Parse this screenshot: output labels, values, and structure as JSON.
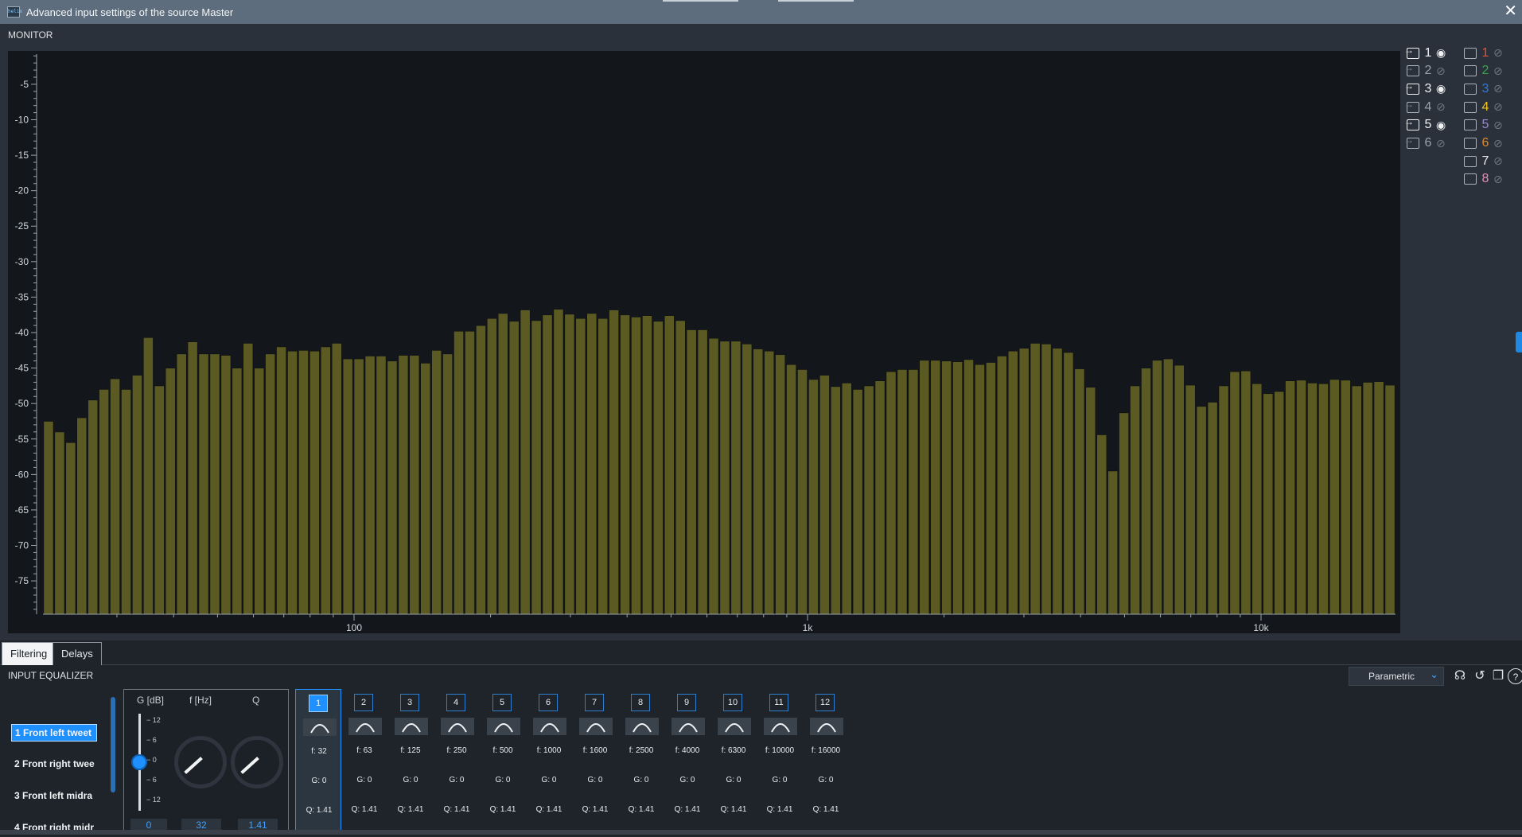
{
  "window": {
    "title": "Advanced input settings of the source Master",
    "close_glyph": "✕"
  },
  "monitor": {
    "label": "MONITOR",
    "help_glyph": "?",
    "input_channels": [
      {
        "num": "1",
        "visible": true
      },
      {
        "num": "2",
        "visible": false
      },
      {
        "num": "3",
        "visible": true
      },
      {
        "num": "4",
        "visible": false
      },
      {
        "num": "5",
        "visible": true
      },
      {
        "num": "6",
        "visible": false
      }
    ],
    "output_channels": [
      {
        "num": "1",
        "color": "#e0533a"
      },
      {
        "num": "2",
        "color": "#3aa34a"
      },
      {
        "num": "3",
        "color": "#2e7bd6"
      },
      {
        "num": "4",
        "color": "#f3c324"
      },
      {
        "num": "5",
        "color": "#9a8ad0"
      },
      {
        "num": "6",
        "color": "#e08a2a"
      },
      {
        "num": "7",
        "color": "#e9ecef"
      },
      {
        "num": "8",
        "color": "#e48fb8"
      }
    ]
  },
  "chart_data": {
    "type": "bar",
    "title": "",
    "xlabel": "",
    "ylabel": "",
    "x_scale": "log",
    "x_tick_labels": [
      "100",
      "1k",
      "10k"
    ],
    "y_tick_labels": [
      "-5",
      "-10",
      "-15",
      "-20",
      "-25",
      "-30",
      "-35",
      "-40",
      "-45",
      "-50",
      "-55",
      "-60",
      "-65",
      "-70",
      "-75"
    ],
    "ylim": [
      -79.7,
      -0.3
    ],
    "bar_color": "#5a5a22",
    "values": [
      -52.5,
      -54,
      -55.5,
      -52,
      -49.5,
      -48,
      -46.5,
      -48,
      -46,
      -40.7,
      -47.5,
      -45,
      -43,
      -41.3,
      -43,
      -43,
      -43.2,
      -45,
      -41.5,
      -45,
      -43,
      -42,
      -42.6,
      -42.5,
      -42.6,
      -42,
      -41.5,
      -43.7,
      -43.7,
      -43.3,
      -43.3,
      -44,
      -43.2,
      -43.2,
      -44.3,
      -42.5,
      -43,
      -39.8,
      -39.8,
      -39,
      -38,
      -37.3,
      -38.4,
      -36.8,
      -38.3,
      -37.5,
      -36.7,
      -37.4,
      -38,
      -37.3,
      -38,
      -36.8,
      -37.5,
      -37.8,
      -37.6,
      -38.4,
      -37.6,
      -38.3,
      -39.6,
      -39.6,
      -40.8,
      -41.2,
      -41.2,
      -41.6,
      -42.3,
      -42.6,
      -43.1,
      -44.5,
      -45.2,
      -46.6,
      -46,
      -47.6,
      -47.1,
      -48,
      -47.5,
      -46.8,
      -45.5,
      -45.2,
      -45.2,
      -43.9,
      -43.9,
      -44,
      -44.1,
      -43.8,
      -44.5,
      -44.2,
      -43.3,
      -42.6,
      -42.2,
      -41.5,
      -41.6,
      -42.2,
      -42.8,
      -45.1,
      -47.7,
      -54.4,
      -59.5,
      -51.3,
      -47.5,
      -45,
      -43.9,
      -43.7,
      -44.6,
      -47.4,
      -50.4,
      -49.8,
      -47.5,
      -45.5,
      -45.4,
      -47.2,
      -48.6,
      -48.3,
      -46.8,
      -46.7,
      -47.1,
      -47.2,
      -46.6,
      -46.7,
      -47.5,
      -47,
      -46.9,
      -47.4
    ]
  },
  "tabs": {
    "filtering": "Filtering",
    "delays": "Delays"
  },
  "equalizer": {
    "label": "INPUT EQUALIZER",
    "mode": "Parametric",
    "channels": [
      "1  Front left tweet",
      "2  Front right twee",
      "3  Front left midra",
      "4  Front right midr"
    ],
    "headers": {
      "gain": "G [dB]",
      "freq": "f [Hz]",
      "q": "Q"
    },
    "gain_ticks": [
      "12",
      "6",
      "0",
      "6",
      "12"
    ],
    "gain_level_db": 0,
    "values": {
      "gain": "0",
      "freq": "32",
      "q": "1.41"
    },
    "bands": [
      {
        "num": "1",
        "f": "f:  32",
        "g": "G:  0",
        "q": "Q:  1.41"
      },
      {
        "num": "2",
        "f": "f:  63",
        "g": "G:  0",
        "q": "Q:  1.41"
      },
      {
        "num": "3",
        "f": "f:  125",
        "g": "G:  0",
        "q": "Q:  1.41"
      },
      {
        "num": "4",
        "f": "f:  250",
        "g": "G:  0",
        "q": "Q:  1.41"
      },
      {
        "num": "5",
        "f": "f:  500",
        "g": "G:  0",
        "q": "Q:  1.41"
      },
      {
        "num": "6",
        "f": "f:  1000",
        "g": "G:  0",
        "q": "Q:  1.41"
      },
      {
        "num": "7",
        "f": "f:  1600",
        "g": "G:  0",
        "q": "Q:  1.41"
      },
      {
        "num": "8",
        "f": "f:  2500",
        "g": "G:  0",
        "q": "Q:  1.41"
      },
      {
        "num": "9",
        "f": "f:  4000",
        "g": "G:  0",
        "q": "Q:  1.41"
      },
      {
        "num": "10",
        "f": "f:  6300",
        "g": "G:  0",
        "q": "Q:  1.41"
      },
      {
        "num": "11",
        "f": "f:  10000",
        "g": "G:  0",
        "q": "Q:  1.41"
      },
      {
        "num": "12",
        "f": "f:  16000",
        "g": "G:  0",
        "q": "Q:  1.41"
      }
    ]
  }
}
